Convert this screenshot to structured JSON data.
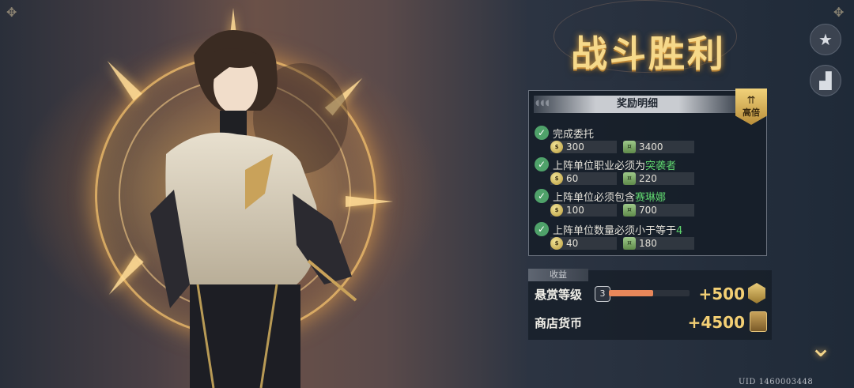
{
  "title": "战斗胜利",
  "side_buttons": [
    {
      "icon": "star-icon",
      "glyph": "★"
    },
    {
      "icon": "stats-chart-icon",
      "glyph": "▟"
    }
  ],
  "reward_panel": {
    "header": "奖励明细",
    "multiplier_label": "高倍",
    "tasks": [
      {
        "prefix": "完成委托",
        "highlight": "",
        "reward_a": "300",
        "reward_b": "3400"
      },
      {
        "prefix": "上阵单位职业必须为",
        "highlight": "突袭者",
        "reward_a": "60",
        "reward_b": "220"
      },
      {
        "prefix": "上阵单位必须包含",
        "highlight": "赛琳娜",
        "reward_a": "100",
        "reward_b": "700"
      },
      {
        "prefix": "上阵单位数量必须小于等于",
        "highlight": "4",
        "reward_a": "40",
        "reward_b": "180"
      }
    ]
  },
  "income": {
    "tab_label": "收益",
    "bounty_label": "悬赏等级",
    "bounty_level": "3",
    "bounty_progress": 0.55,
    "bounty_gain": "+500",
    "shop_label": "商店货币",
    "shop_gain": "+4500"
  },
  "uid": "UID 1460003448",
  "colors": {
    "accent_gold": "#f3cf74",
    "highlight_green": "#5fd46e",
    "progress": "#e8875a"
  }
}
